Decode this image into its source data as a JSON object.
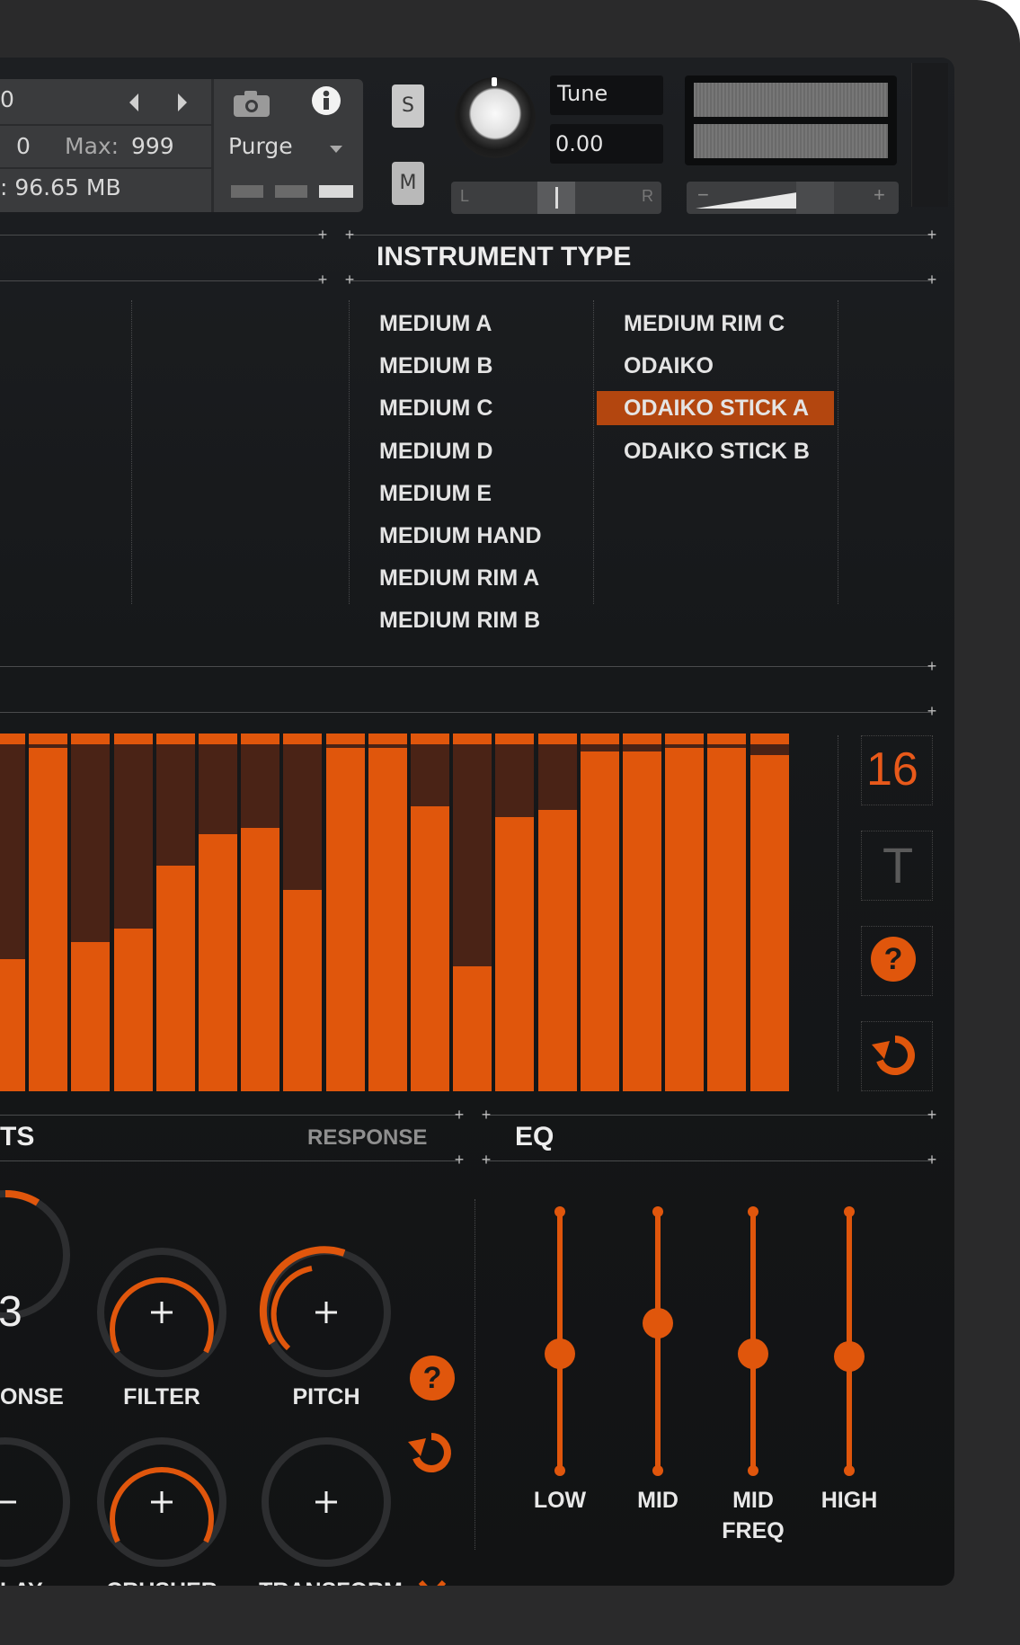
{
  "header": {
    "left_value": "0",
    "min_value": "0",
    "max_label": "Max:",
    "max_value": "999",
    "memory": ": 96.65 MB",
    "purge_label": "Purge",
    "solo_label": "S",
    "mute_label": "M",
    "tune_label": "Tune",
    "tune_value": "0.00",
    "pan_left": "L",
    "pan_right": "R",
    "vol_minus": "−",
    "vol_plus": "+"
  },
  "instrument_type": {
    "title": "INSTRUMENT TYPE",
    "column1": [
      "MEDIUM A",
      "MEDIUM B",
      "MEDIUM C",
      "MEDIUM D",
      "MEDIUM E",
      "MEDIUM HAND",
      "MEDIUM RIM A",
      "MEDIUM RIM B"
    ],
    "column2": [
      "MEDIUM RIM C",
      "ODAIKO",
      "ODAIKO STICK A",
      "ODAIKO STICK B"
    ],
    "selected": "ODAIKO STICK A"
  },
  "sequencer": {
    "steps": "16",
    "t_label": "T",
    "values": [
      0.38,
      0.99,
      0.43,
      0.47,
      0.65,
      0.74,
      0.76,
      0.58,
      0.99,
      0.99,
      0.82,
      0.36,
      0.79,
      0.81,
      0.98,
      0.98,
      0.99,
      0.99,
      0.97
    ]
  },
  "effects": {
    "title": "TS",
    "response_label": "RESPONSE",
    "big_value": "3",
    "labels": [
      "ONSE",
      "FILTER",
      "PITCH",
      "LAY",
      "CRUSHER",
      "TRANSFORM"
    ]
  },
  "eq": {
    "title": "EQ",
    "bands": [
      {
        "label": "LOW",
        "level": 0.45
      },
      {
        "label": "MID",
        "level": 0.57
      },
      {
        "label": "MID\nFREQ",
        "level": 0.45
      },
      {
        "label": "HIGH",
        "level": 0.44
      }
    ]
  },
  "colors": {
    "accent": "#e0560c",
    "selected": "#b3460f",
    "panel": "#1a1b1d"
  }
}
